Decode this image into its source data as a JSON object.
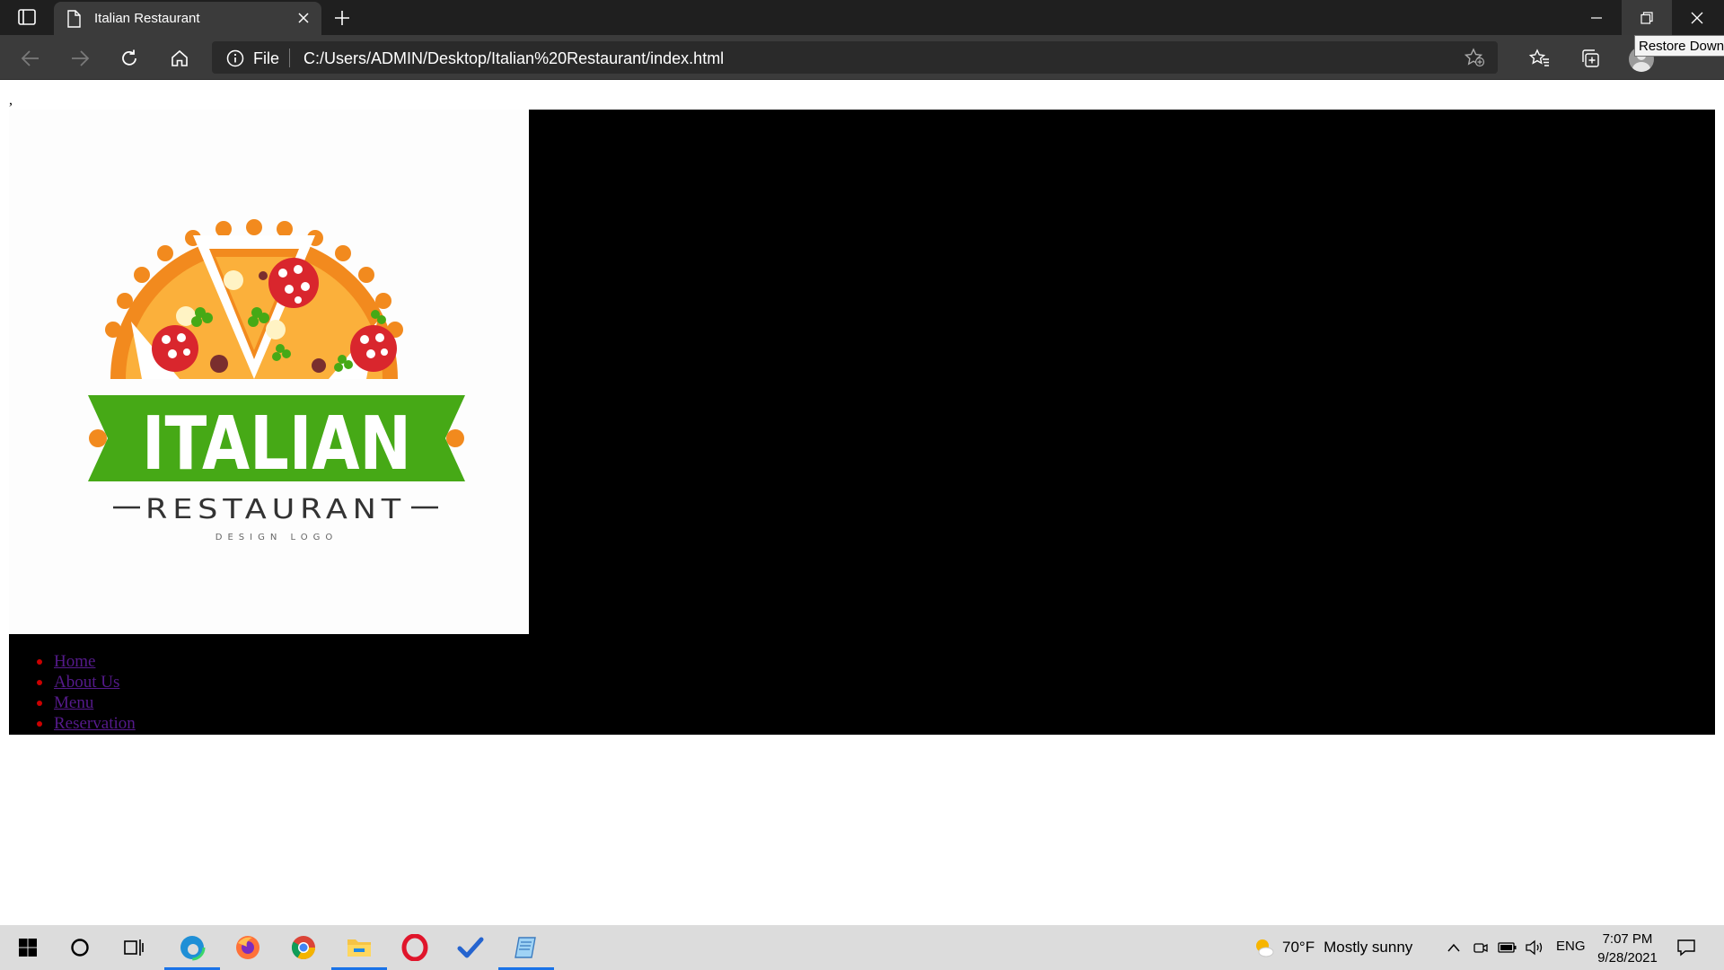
{
  "browser": {
    "tab": {
      "title": "Italian Restaurant",
      "icon": "page-icon"
    },
    "address": {
      "scheme_label": "File",
      "url": "C:/Users/ADMIN/Desktop/Italian%20Restaurant/index.html"
    },
    "tooltip": "Restore Down",
    "more_label": "···"
  },
  "page": {
    "stray_text": ",",
    "logo": {
      "word_main": "ITALIAN",
      "word_sub": "RESTAURANT",
      "word_tiny": "DESIGN LOGO"
    },
    "nav": [
      {
        "label": "Home"
      },
      {
        "label": "About Us"
      },
      {
        "label": "Menu"
      },
      {
        "label": "Reservation"
      }
    ]
  },
  "taskbar": {
    "weather": {
      "temp": "70°F",
      "desc": "Mostly sunny"
    },
    "lang": "ENG",
    "time": "7:07 PM",
    "date": "9/28/2021"
  },
  "colors": {
    "logo_green": "#46a916",
    "logo_orange": "#f28a1e",
    "pepperoni_red": "#d9262d",
    "link_visited": "#551a8b",
    "bullet_red": "#cc0000"
  }
}
